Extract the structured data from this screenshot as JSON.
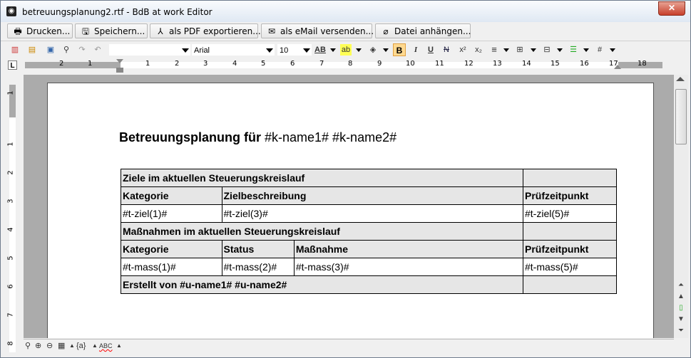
{
  "window": {
    "title": "betreuungsplanung2.rtf - BdB at work Editor",
    "close_label": "✕"
  },
  "actions": [
    {
      "label": "Drucken...",
      "icon": "printer-icon",
      "glyph": "🖶"
    },
    {
      "label": "Speichern...",
      "icon": "save-icon",
      "glyph": "🖫"
    },
    {
      "label": "als PDF exportieren...",
      "icon": "pdf-icon",
      "glyph": "⅄"
    },
    {
      "label": "als eMail versenden...",
      "icon": "email-icon",
      "glyph": "✉"
    },
    {
      "label": "Datei anhängen...",
      "icon": "paperclip-icon",
      "glyph": "⌀"
    }
  ],
  "toolbar": {
    "style_value": "",
    "font_value": "Arial",
    "size_value": "10",
    "bold": "B",
    "italic": "I",
    "underline": "U",
    "strike": "N",
    "superscript": "x²",
    "subscript": "x₂",
    "hash": "#",
    "ruler_corner": "L"
  },
  "ruler": {
    "numbers": [
      "2",
      "1",
      "1",
      "2",
      "3",
      "4",
      "5",
      "6",
      "7",
      "8",
      "9",
      "10",
      "11",
      "12",
      "13",
      "14",
      "15",
      "16",
      "17",
      "18"
    ],
    "vnumbers": [
      "1",
      "1",
      "2",
      "3",
      "4",
      "5",
      "6",
      "7",
      "8"
    ]
  },
  "document": {
    "title_bold": "Betreuungsplanung für ",
    "title_vars": "#k-name1# #k-name2#",
    "table": {
      "goals_header": "Ziele im aktuellen Steuerungskreislauf",
      "goals_cols": [
        "Kategorie",
        "Zielbeschreibung",
        "Prüfzeitpunkt"
      ],
      "goals_row": [
        "#t-ziel(1)#",
        "#t-ziel(3)#",
        "#t-ziel(5)#"
      ],
      "measures_header": "Maßnahmen im aktuellen Steuerungskreislauf",
      "measures_cols": [
        "Kategorie",
        "Status",
        "Maßnahme",
        "Prüfzeitpunkt"
      ],
      "measures_row": [
        "#t-mass(1)#",
        "#t-mass(2)#",
        "#t-mass(3)#",
        "#t-mass(5)#"
      ],
      "footer": "Erstellt von #u-name1# #u-name2#"
    }
  },
  "statusbar": {
    "field_label": "{a}",
    "spell_label": "ABC"
  },
  "colors": {
    "table_header_bg": "#e6e6e6",
    "bold_active_bg": "#ffd990",
    "workspace_bg": "#ababab"
  }
}
